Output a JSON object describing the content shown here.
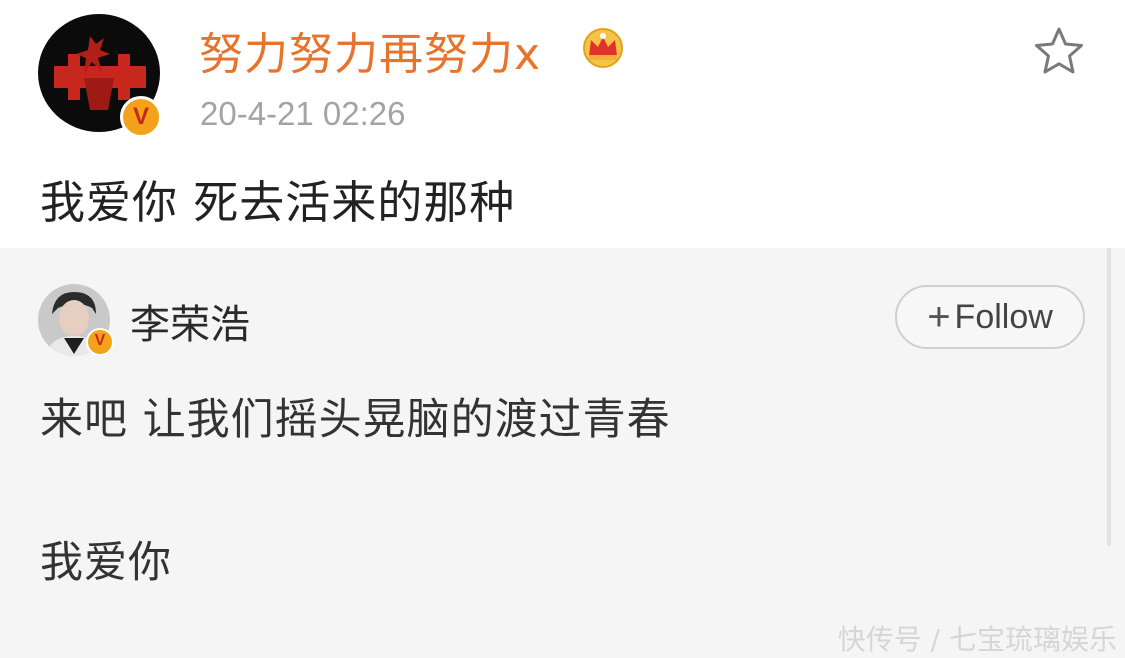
{
  "post": {
    "author_name": "努力努力再努力x",
    "timestamp": "20-4-21 02:26",
    "text": "我爱你 死去活来的那种",
    "verified_badge": "V",
    "icons": {
      "favorite": "star-outline-icon",
      "membership": "crown-icon"
    },
    "colors": {
      "name": "#e8732a",
      "timestamp": "#a3a3a3",
      "badge": "#f4a21a"
    }
  },
  "quoted": {
    "author_name": "李荣浩",
    "verified_badge": "V",
    "follow_plus": "+",
    "follow_label": "Follow",
    "line1": "来吧 让我们摇头晃脑的渡过青春",
    "line2": "我爱你"
  },
  "watermark": "快传号 / 七宝琉璃娱乐"
}
